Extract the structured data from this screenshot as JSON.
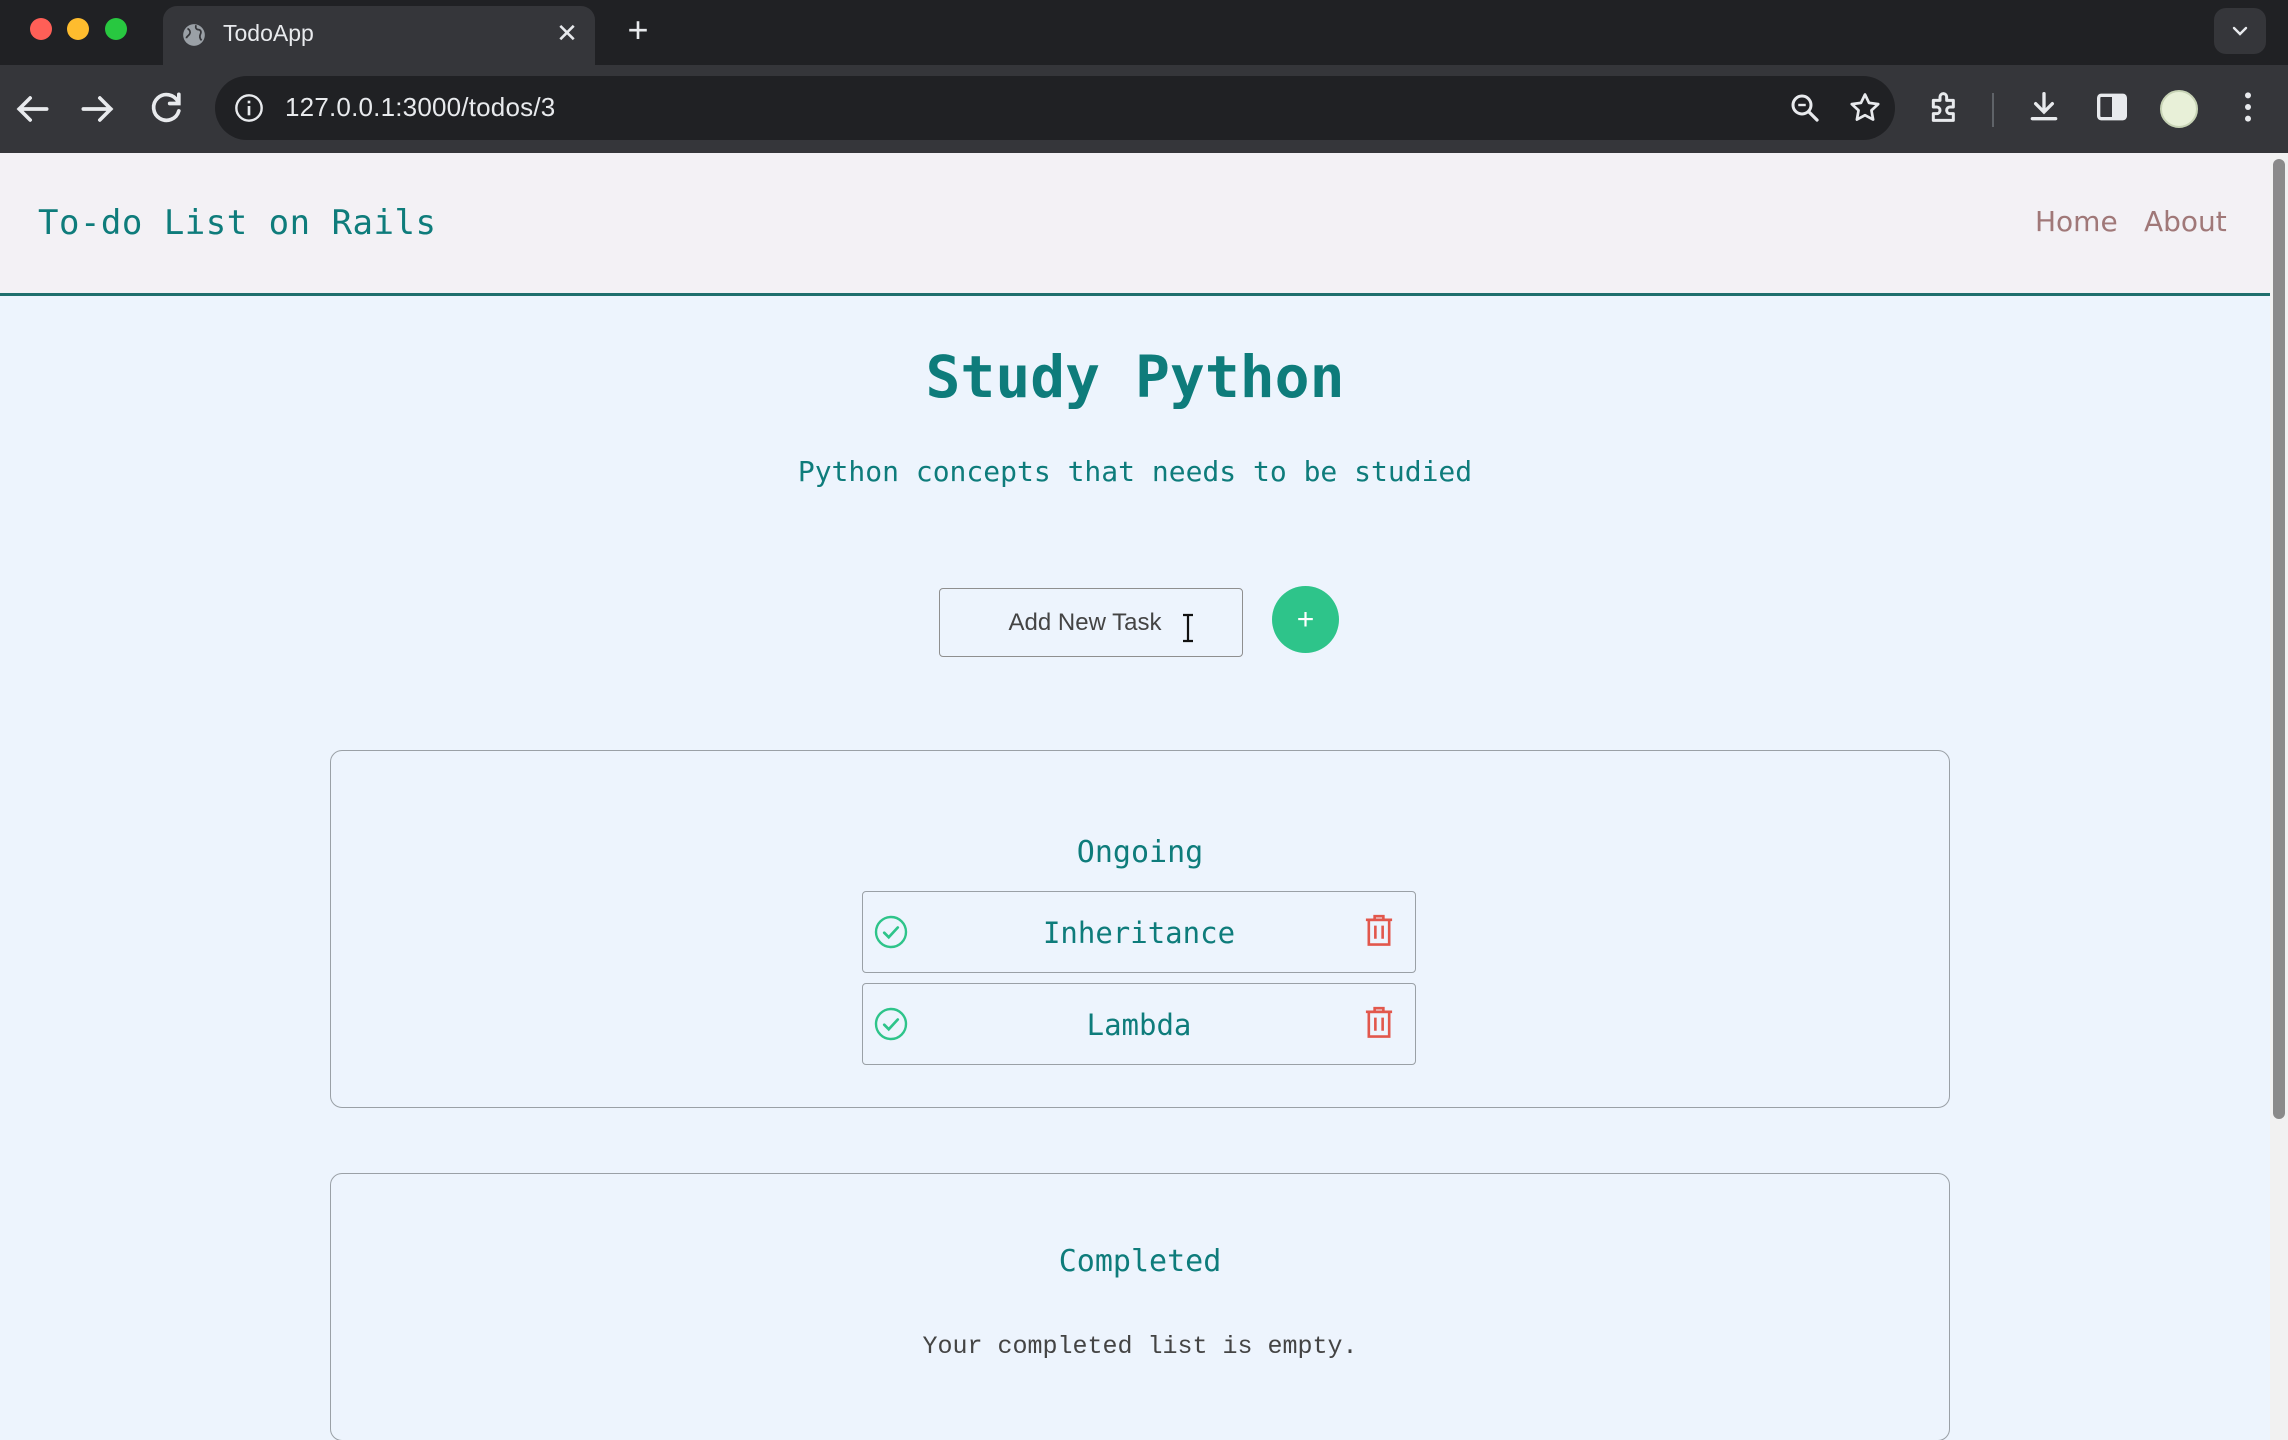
{
  "browser": {
    "tab_title": "TodoApp",
    "url": "127.0.0.1:3000/todos/3",
    "new_tab_symbol": "+",
    "close_symbol": "✕"
  },
  "navbar": {
    "brand": "To-do List on Rails",
    "links": [
      "Home",
      "About"
    ]
  },
  "todo": {
    "title": "Study Python",
    "description": "Python concepts that needs to be studied"
  },
  "new_task": {
    "placeholder": "Add New Task",
    "button_label": "+"
  },
  "ongoing": {
    "heading": "Ongoing",
    "tasks": [
      "Inheritance",
      "Lambda"
    ]
  },
  "completed": {
    "heading": "Completed",
    "empty_message": "Your completed list is empty."
  },
  "colors": {
    "accent_teal": "#0e7c7b",
    "add_button": "#2ec48a",
    "trash_red": "#e2574c",
    "page_bg": "#edf4fd"
  },
  "icons": {
    "complete": "check-circle-icon",
    "delete": "trash-icon"
  }
}
